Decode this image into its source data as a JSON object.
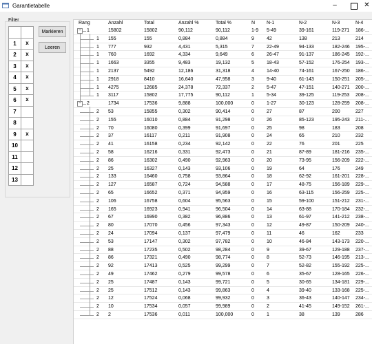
{
  "window": {
    "title": "Garantietabelle",
    "min_icon": "minimize-icon",
    "max_icon": "maximize-icon",
    "close_icon": "close-icon",
    "close_label": "✕"
  },
  "filter": {
    "label": "Filter",
    "rows": [
      {
        "n": "",
        "x": ""
      },
      {
        "n": "1",
        "x": "x"
      },
      {
        "n": "2",
        "x": "x"
      },
      {
        "n": "3",
        "x": "x"
      },
      {
        "n": "4",
        "x": "x"
      },
      {
        "n": "5",
        "x": "x"
      },
      {
        "n": "6",
        "x": "x"
      },
      {
        "n": "7",
        "x": ""
      },
      {
        "n": "8",
        "x": ""
      },
      {
        "n": "9",
        "x": "x"
      },
      {
        "n": "10",
        "x": ""
      },
      {
        "n": "11",
        "x": ""
      },
      {
        "n": "12",
        "x": ""
      },
      {
        "n": "13",
        "x": ""
      }
    ],
    "mark_button": "Markieren",
    "reset_button": "Leeren"
  },
  "columns": [
    "Rang",
    "Anzahl",
    "Total",
    "Anzahl %",
    "Total %",
    "N",
    "N-1",
    "N-2",
    "N-3",
    "N-4"
  ],
  "rows": [
    {
      "level": 1,
      "rang": "1",
      "anzahl": "15802",
      "total": "15802",
      "pct": "90,112",
      "tpct": "90,112",
      "n": "1-9",
      "n1": "5-49",
      "n2": "39-161",
      "n3": "119-271",
      "n4": "186-..."
    },
    {
      "level": 2,
      "rang": "1",
      "anzahl": "155",
      "total": "155",
      "pct": "0,884",
      "tpct": "0,884",
      "n": "9",
      "n1": "42",
      "n2": "138",
      "n3": "213",
      "n4": "214"
    },
    {
      "level": 2,
      "rang": "1",
      "anzahl": "777",
      "total": "932",
      "pct": "4,431",
      "tpct": "5,315",
      "n": "7",
      "n1": "22-49",
      "n2": "94-133",
      "n3": "182-246",
      "n4": "195-..."
    },
    {
      "level": 2,
      "rang": "1",
      "anzahl": "760",
      "total": "1692",
      "pct": "4,334",
      "tpct": "9,649",
      "n": "6",
      "n1": "26-47",
      "n2": "91-137",
      "n3": "186-245",
      "n4": "192-..."
    },
    {
      "level": 2,
      "rang": "1",
      "anzahl": "1663",
      "total": "3355",
      "pct": "9,483",
      "tpct": "19,132",
      "n": "5",
      "n1": "18-43",
      "n2": "57-152",
      "n3": "176-254",
      "n4": "193-..."
    },
    {
      "level": 2,
      "rang": "1",
      "anzahl": "2137",
      "total": "5492",
      "pct": "12,186",
      "tpct": "31,318",
      "n": "4",
      "n1": "14-40",
      "n2": "74-161",
      "n3": "167-250",
      "n4": "186-..."
    },
    {
      "level": 2,
      "rang": "1",
      "anzahl": "2918",
      "total": "8410",
      "pct": "16,640",
      "tpct": "47,958",
      "n": "3",
      "n1": "9-40",
      "n2": "61-143",
      "n3": "150-251",
      "n4": "205-..."
    },
    {
      "level": 2,
      "rang": "1",
      "anzahl": "4275",
      "total": "12685",
      "pct": "24,378",
      "tpct": "72,337",
      "n": "2",
      "n1": "5-47",
      "n2": "47-151",
      "n3": "140-271",
      "n4": "200-..."
    },
    {
      "level": 2,
      "rang": "1",
      "anzahl": "3117",
      "total": "15802",
      "pct": "17,775",
      "tpct": "90,112",
      "n": "1",
      "n1": "5-34",
      "n2": "39-125",
      "n3": "119-253",
      "n4": "208-..."
    },
    {
      "level": 1,
      "rang": "2",
      "anzahl": "1734",
      "total": "17536",
      "pct": "9,888",
      "tpct": "100,000",
      "n": "0",
      "n1": "1-27",
      "n2": "30-123",
      "n3": "128-259",
      "n4": "208-..."
    },
    {
      "level": 2,
      "rang": "2",
      "anzahl": "53",
      "total": "15855",
      "pct": "0,302",
      "tpct": "90,414",
      "n": "0",
      "n1": "27",
      "n2": "87",
      "n3": "200",
      "n4": "227"
    },
    {
      "level": 2,
      "rang": "2",
      "anzahl": "155",
      "total": "16010",
      "pct": "0,884",
      "tpct": "91,298",
      "n": "0",
      "n1": "26",
      "n2": "85-123",
      "n3": "195-243",
      "n4": "211-..."
    },
    {
      "level": 2,
      "rang": "2",
      "anzahl": "70",
      "total": "16080",
      "pct": "0,399",
      "tpct": "91,697",
      "n": "0",
      "n1": "25",
      "n2": "98",
      "n3": "183",
      "n4": "208"
    },
    {
      "level": 2,
      "rang": "2",
      "anzahl": "37",
      "total": "16117",
      "pct": "0,211",
      "tpct": "91,908",
      "n": "0",
      "n1": "24",
      "n2": "65",
      "n3": "210",
      "n4": "232"
    },
    {
      "level": 2,
      "rang": "2",
      "anzahl": "41",
      "total": "16158",
      "pct": "0,234",
      "tpct": "92,142",
      "n": "0",
      "n1": "22",
      "n2": "76",
      "n3": "201",
      "n4": "225"
    },
    {
      "level": 2,
      "rang": "2",
      "anzahl": "58",
      "total": "16216",
      "pct": "0,331",
      "tpct": "92,473",
      "n": "0",
      "n1": "21",
      "n2": "87-89",
      "n3": "181-216",
      "n4": "235-..."
    },
    {
      "level": 2,
      "rang": "2",
      "anzahl": "86",
      "total": "16302",
      "pct": "0,490",
      "tpct": "92,963",
      "n": "0",
      "n1": "20",
      "n2": "73-95",
      "n3": "156-209",
      "n4": "222-..."
    },
    {
      "level": 2,
      "rang": "2",
      "anzahl": "25",
      "total": "16327",
      "pct": "0,143",
      "tpct": "93,106",
      "n": "0",
      "n1": "19",
      "n2": "64",
      "n3": "176",
      "n4": "249"
    },
    {
      "level": 2,
      "rang": "2",
      "anzahl": "133",
      "total": "16460",
      "pct": "0,758",
      "tpct": "93,864",
      "n": "0",
      "n1": "18",
      "n2": "62-92",
      "n3": "161-201",
      "n4": "228-..."
    },
    {
      "level": 2,
      "rang": "2",
      "anzahl": "127",
      "total": "16587",
      "pct": "0,724",
      "tpct": "94,588",
      "n": "0",
      "n1": "17",
      "n2": "48-75",
      "n3": "156-189",
      "n4": "229-..."
    },
    {
      "level": 2,
      "rang": "2",
      "anzahl": "65",
      "total": "16652",
      "pct": "0,371",
      "tpct": "94,959",
      "n": "0",
      "n1": "16",
      "n2": "63-115",
      "n3": "156-259",
      "n4": "225-..."
    },
    {
      "level": 2,
      "rang": "2",
      "anzahl": "106",
      "total": "16758",
      "pct": "0,604",
      "tpct": "95,563",
      "n": "0",
      "n1": "15",
      "n2": "59-100",
      "n3": "151-212",
      "n4": "231-..."
    },
    {
      "level": 2,
      "rang": "2",
      "anzahl": "165",
      "total": "16923",
      "pct": "0,941",
      "tpct": "96,504",
      "n": "0",
      "n1": "14",
      "n2": "63-88",
      "n3": "170-184",
      "n4": "232-..."
    },
    {
      "level": 2,
      "rang": "2",
      "anzahl": "67",
      "total": "16990",
      "pct": "0,382",
      "tpct": "96,886",
      "n": "0",
      "n1": "13",
      "n2": "61-97",
      "n3": "141-212",
      "n4": "238-..."
    },
    {
      "level": 2,
      "rang": "2",
      "anzahl": "80",
      "total": "17070",
      "pct": "0,456",
      "tpct": "97,343",
      "n": "0",
      "n1": "12",
      "n2": "49-87",
      "n3": "150-209",
      "n4": "240-..."
    },
    {
      "level": 2,
      "rang": "2",
      "anzahl": "24",
      "total": "17094",
      "pct": "0,137",
      "tpct": "97,479",
      "n": "0",
      "n1": "11",
      "n2": "46",
      "n3": "162",
      "n4": "233"
    },
    {
      "level": 2,
      "rang": "2",
      "anzahl": "53",
      "total": "17147",
      "pct": "0,302",
      "tpct": "97,782",
      "n": "0",
      "n1": "10",
      "n2": "46-84",
      "n3": "143-173",
      "n4": "220-..."
    },
    {
      "level": 2,
      "rang": "2",
      "anzahl": "88",
      "total": "17235",
      "pct": "0,502",
      "tpct": "98,284",
      "n": "0",
      "n1": "9",
      "n2": "39-67",
      "n3": "129-188",
      "n4": "237-..."
    },
    {
      "level": 2,
      "rang": "2",
      "anzahl": "86",
      "total": "17321",
      "pct": "0,490",
      "tpct": "98,774",
      "n": "0",
      "n1": "8",
      "n2": "52-73",
      "n3": "146-195",
      "n4": "213-..."
    },
    {
      "level": 2,
      "rang": "2",
      "anzahl": "92",
      "total": "17413",
      "pct": "0,525",
      "tpct": "99,299",
      "n": "0",
      "n1": "7",
      "n2": "52-82",
      "n3": "155-192",
      "n4": "225-..."
    },
    {
      "level": 2,
      "rang": "2",
      "anzahl": "49",
      "total": "17462",
      "pct": "0,279",
      "tpct": "99,578",
      "n": "0",
      "n1": "6",
      "n2": "35-67",
      "n3": "128-165",
      "n4": "226-..."
    },
    {
      "level": 2,
      "rang": "2",
      "anzahl": "25",
      "total": "17487",
      "pct": "0,143",
      "tpct": "99,721",
      "n": "0",
      "n1": "5",
      "n2": "30-65",
      "n3": "134-181",
      "n4": "229-..."
    },
    {
      "level": 2,
      "rang": "2",
      "anzahl": "25",
      "total": "17512",
      "pct": "0,143",
      "tpct": "99,863",
      "n": "0",
      "n1": "4",
      "n2": "39-40",
      "n3": "133-168",
      "n4": "225-..."
    },
    {
      "level": 2,
      "rang": "2",
      "anzahl": "12",
      "total": "17524",
      "pct": "0,068",
      "tpct": "99,932",
      "n": "0",
      "n1": "3",
      "n2": "36-43",
      "n3": "140-147",
      "n4": "234-..."
    },
    {
      "level": 2,
      "rang": "2",
      "anzahl": "10",
      "total": "17534",
      "pct": "0,057",
      "tpct": "99,989",
      "n": "0",
      "n1": "2",
      "n2": "41-45",
      "n3": "149-152",
      "n4": "261-..."
    },
    {
      "level": 2,
      "rang": "2",
      "anzahl": "2",
      "total": "17536",
      "pct": "0,011",
      "tpct": "100,000",
      "n": "0",
      "n1": "1",
      "n2": "38",
      "n3": "139",
      "n4": "286"
    }
  ]
}
